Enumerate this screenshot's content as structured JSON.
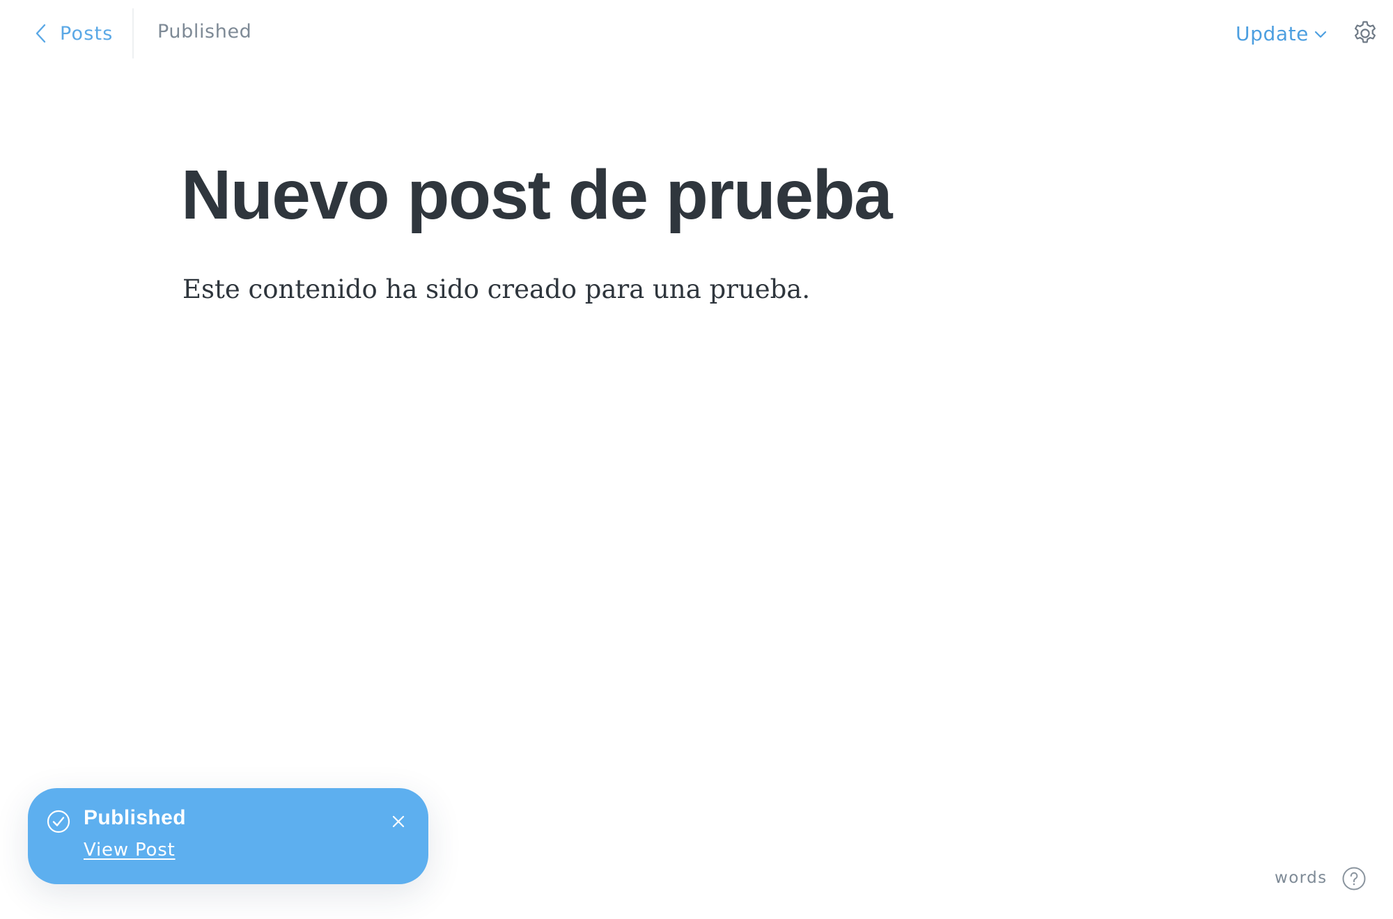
{
  "header": {
    "back_label": "Posts",
    "back_icon": "chevron-left-icon",
    "status": "Published",
    "update_label": "Update",
    "update_icon": "chevron-down-icon",
    "settings_icon": "gear-icon",
    "accent_color": "#5aa8e6"
  },
  "post": {
    "title": "Nuevo post de prueba",
    "body": "Este contenido ha sido creado para una prueba."
  },
  "toast": {
    "title": "Published",
    "link_label": "View Post",
    "status_icon": "check-circle-icon",
    "close_icon": "close-icon",
    "background_color": "#5dafef"
  },
  "footer": {
    "word_count_label": "words",
    "help_icon": "question-circle-icon"
  }
}
